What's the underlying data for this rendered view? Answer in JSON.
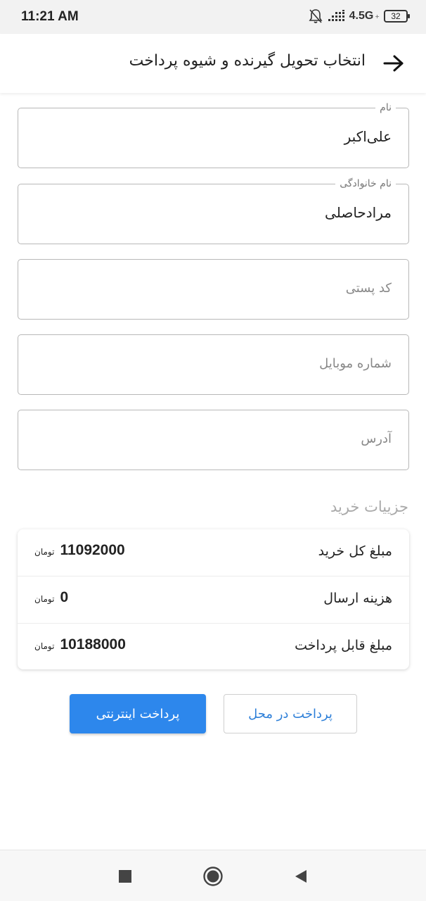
{
  "status_bar": {
    "time": "11:21 AM",
    "network": "4.5G",
    "network_sub": "+",
    "battery": "32",
    "icons": [
      "mute-bell-icon",
      "signal-icon",
      "battery-icon"
    ]
  },
  "app_bar": {
    "title": "انتخاب تحویل گیرنده و شیوه پرداخت",
    "back_icon": "arrow-right-icon"
  },
  "form": {
    "first_name": {
      "label": "نام",
      "value": "علی‌اکبر"
    },
    "last_name": {
      "label": "نام خانوادگی",
      "value": "مرادحاصلی"
    },
    "postal_code": {
      "placeholder": "کد پستی"
    },
    "mobile": {
      "placeholder": "شماره موبایل"
    },
    "address": {
      "placeholder": "آدرس"
    }
  },
  "purchase_details": {
    "title": "جزییات خرید",
    "rows": [
      {
        "label": "مبلغ کل خرید",
        "value": "11092000",
        "currency": "تومان"
      },
      {
        "label": "هزینه ارسال",
        "value": "0",
        "currency": "تومان"
      },
      {
        "label": "مبلغ قابل پرداخت",
        "value": "10188000",
        "currency": "تومان"
      }
    ]
  },
  "actions": {
    "online_payment": "پرداخت اینترنتی",
    "cash_on_delivery": "پرداخت در محل"
  },
  "colors": {
    "primary": "#2d87ec",
    "secondary_text": "#2d7fd8",
    "field_border": "#b8b8b8"
  },
  "nav_bar": {
    "icons": [
      "recent-apps-icon",
      "home-icon",
      "back-icon"
    ]
  }
}
